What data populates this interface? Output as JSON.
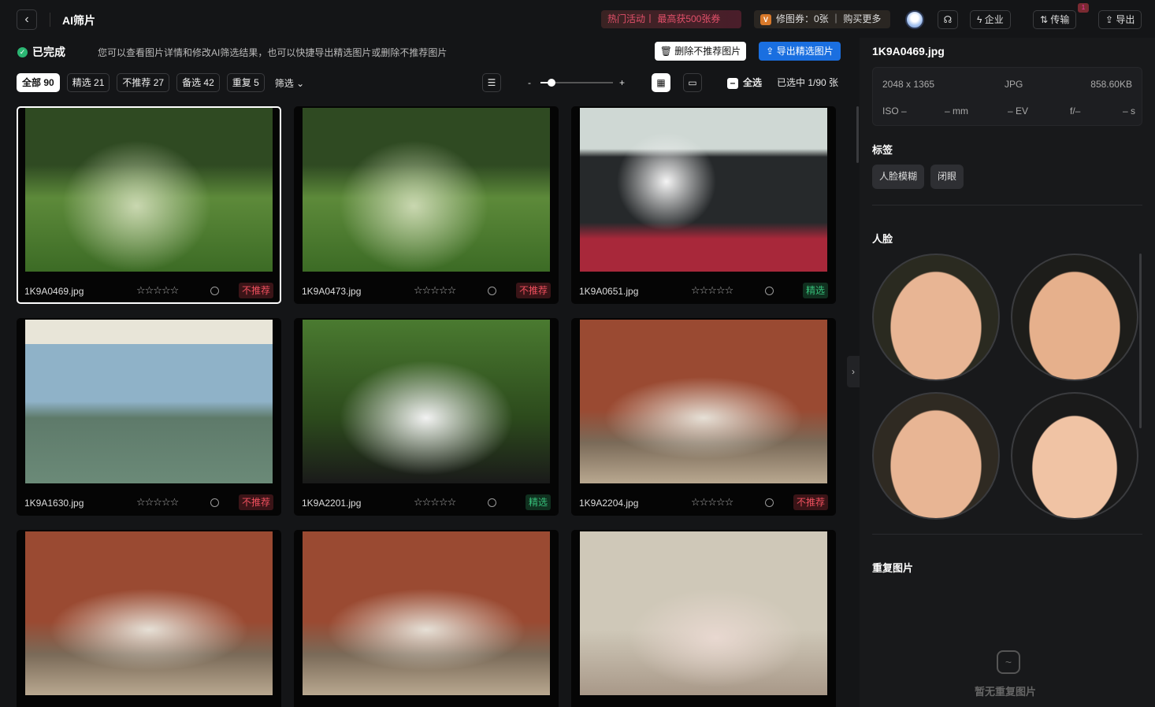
{
  "header": {
    "title": "AI筛片",
    "promo": "热门活动丨 最高获500张券",
    "coupon": "修图券：0张 ｜ 购买更多",
    "coupon_icon": "V",
    "enterprise": "企业",
    "transfer": "传输",
    "transfer_badge": "1",
    "export": "导出"
  },
  "status": {
    "label": "已完成",
    "hint": "您可以查看图片详情和修改AI筛选结果，也可以快捷导出精选图片或删除不推荐图片",
    "delete_btn": "删除不推荐图片",
    "export_btn": "导出精选图片"
  },
  "filters": [
    {
      "label": "全部 90"
    },
    {
      "label": "精选 21"
    },
    {
      "label": "不推荐 27"
    },
    {
      "label": "备选 42"
    },
    {
      "label": "重复 5"
    }
  ],
  "filter_menu": "筛选",
  "toolbar": {
    "minus": "-",
    "plus": "+",
    "zoom_fraction": 0.15,
    "select_all": "全选",
    "selected": "已选中 1/90 张"
  },
  "photos": [
    {
      "name": "1K9A0469.jpg",
      "tag": "不推荐",
      "kind": "no",
      "scene": "green",
      "selected": true
    },
    {
      "name": "1K9A0473.jpg",
      "tag": "不推荐",
      "kind": "no",
      "scene": "green"
    },
    {
      "name": "1K9A0651.jpg",
      "tag": "精选",
      "kind": "yes",
      "scene": "car"
    },
    {
      "name": "1K9A1630.jpg",
      "tag": "不推荐",
      "kind": "no",
      "scene": "school"
    },
    {
      "name": "1K9A2201.jpg",
      "tag": "精选",
      "kind": "yes",
      "scene": "garden"
    },
    {
      "name": "1K9A2204.jpg",
      "tag": "不推荐",
      "kind": "no",
      "scene": "brick"
    },
    {
      "name": "",
      "tag": "",
      "kind": "",
      "scene": "brick"
    },
    {
      "name": "",
      "tag": "",
      "kind": "",
      "scene": "brick"
    },
    {
      "name": "",
      "tag": "",
      "kind": "",
      "scene": "temple"
    }
  ],
  "stars": "☆☆☆☆☆",
  "panel": {
    "filename": "1K9A0469.jpg",
    "resolution": "2048 x 1365",
    "format": "JPG",
    "size": "858.60KB",
    "iso": "ISO –",
    "focal": "– mm",
    "ev": "– EV",
    "aperture": "f/–",
    "shutter": "– s",
    "tags_title": "标签",
    "tags": [
      "人脸模糊",
      "闭眼"
    ],
    "faces_title": "人脸",
    "dup_title": "重复图片",
    "dup_empty": "暂无重复图片"
  }
}
